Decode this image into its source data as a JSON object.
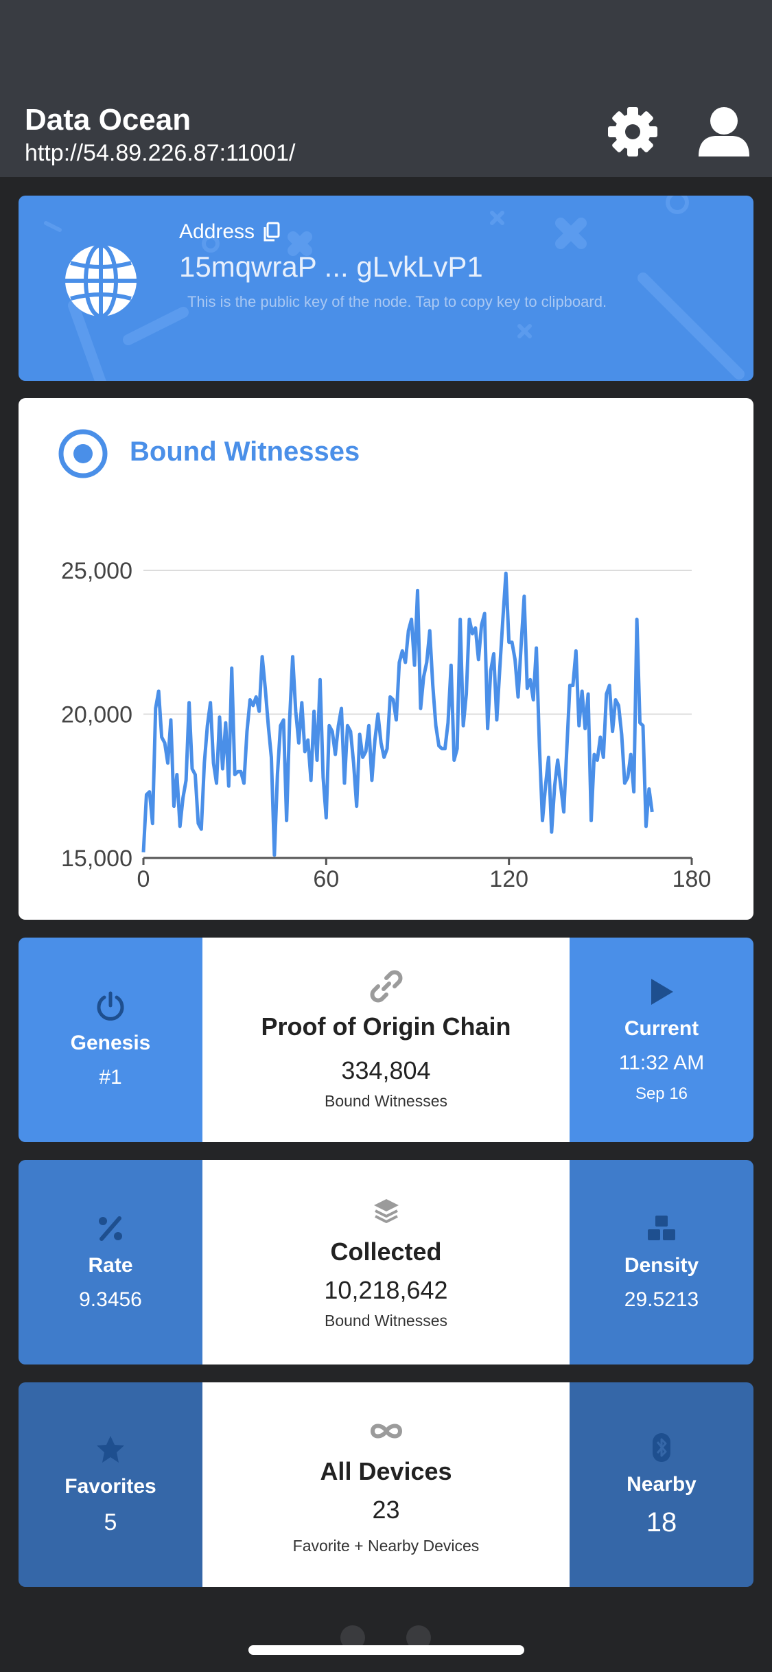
{
  "header": {
    "title": "Data Ocean",
    "url": "http://54.89.226.87:11001/",
    "icons": [
      "gear-icon",
      "user-icon"
    ]
  },
  "address": {
    "label": "Address",
    "key": "15mqwraP ... gLvkLvP1",
    "hint": "This is the public key of the node. Tap to copy key to clipboard.",
    "icon": "globe-icon",
    "copy_icon": "copy-icon"
  },
  "bound_witnesses_chart": {
    "title": "Bound Witnesses",
    "icon": "target-icon"
  },
  "chart_data": {
    "type": "line",
    "title": "Bound Witnesses",
    "xlabel": "",
    "ylabel": "",
    "xlim": [
      0,
      180
    ],
    "ylim": [
      15000,
      25000
    ],
    "xticks": [
      0,
      60,
      120,
      180
    ],
    "yticks": [
      15000,
      20000,
      25000
    ],
    "xtick_labels": [
      "0",
      "60",
      "120",
      "180"
    ],
    "ytick_labels": [
      "15,000",
      "20,000",
      "25,000"
    ],
    "grid": true,
    "color": "#4a8fe8",
    "y": [
      15200,
      17200,
      17300,
      16200,
      20200,
      20800,
      19200,
      19000,
      18300,
      19800,
      16800,
      17900,
      16100,
      17100,
      17700,
      20400,
      18100,
      17900,
      16200,
      16000,
      18300,
      19600,
      20400,
      18300,
      17600,
      19900,
      18100,
      19700,
      17500,
      21600,
      17900,
      18000,
      18000,
      17600,
      19400,
      20500,
      20300,
      20600,
      20100,
      22000,
      20900,
      19600,
      18500,
      15100,
      17900,
      19600,
      19800,
      16300,
      19800,
      22000,
      20100,
      19000,
      20400,
      18700,
      19100,
      17700,
      20100,
      18400,
      21200,
      17800,
      16400,
      19600,
      19400,
      18600,
      19600,
      20200,
      17600,
      19600,
      19400,
      18300,
      16800,
      19300,
      18500,
      18700,
      19600,
      17700,
      19100,
      20000,
      19000,
      18500,
      18800,
      20600,
      20500,
      19800,
      21800,
      22200,
      21800,
      22900,
      23300,
      21700,
      24300,
      20200,
      21300,
      21800,
      22900,
      21000,
      19600,
      18900,
      18800,
      18800,
      19700,
      21700,
      18400,
      18800,
      23300,
      19600,
      20700,
      23300,
      22800,
      23000,
      21900,
      23100,
      23500,
      19500,
      21500,
      22100,
      19800,
      21600,
      23300,
      24900,
      22500,
      22500,
      21900,
      20600,
      22400,
      24100,
      20900,
      21200,
      20500,
      22300,
      18900,
      16300,
      17500,
      18500,
      15900,
      17500,
      18400,
      17500,
      16600,
      18800,
      21000,
      21000,
      22200,
      19600,
      20800,
      19500,
      20700,
      16300,
      18600,
      18400,
      19200,
      18500,
      20700,
      21000,
      19400,
      20500,
      20300,
      19300,
      17600,
      17800,
      18600,
      17300,
      23300,
      19700,
      19600,
      16100,
      17400,
      16600
    ]
  },
  "poo_card": {
    "left": {
      "label": "Genesis",
      "value": "#1",
      "icon": "power-icon"
    },
    "mid": {
      "title": "Proof of Origin Chain",
      "value": "334,804",
      "sub": "Bound Witnesses",
      "icon": "link-icon"
    },
    "right": {
      "label": "Current",
      "value": "11:32 AM",
      "sub": "Sep 16",
      "icon": "play-icon"
    }
  },
  "collected_card": {
    "left": {
      "label": "Rate",
      "value": "9.3456",
      "icon": "percent-icon"
    },
    "mid": {
      "title": "Collected",
      "value": "10,218,642",
      "sub": "Bound Witnesses",
      "icon": "layers-icon"
    },
    "right": {
      "label": "Density",
      "value": "29.5213",
      "icon": "cubes-icon"
    }
  },
  "devices_card": {
    "left": {
      "label": "Favorites",
      "value": "5",
      "icon": "star-icon"
    },
    "mid": {
      "title": "All Devices",
      "value": "23",
      "sub": "Favorite + Nearby Devices",
      "icon": "infinity-icon"
    },
    "right": {
      "label": "Nearby",
      "value": "18",
      "icon": "bluetooth-icon"
    }
  },
  "pager": {
    "pages": 2,
    "current": 2
  }
}
